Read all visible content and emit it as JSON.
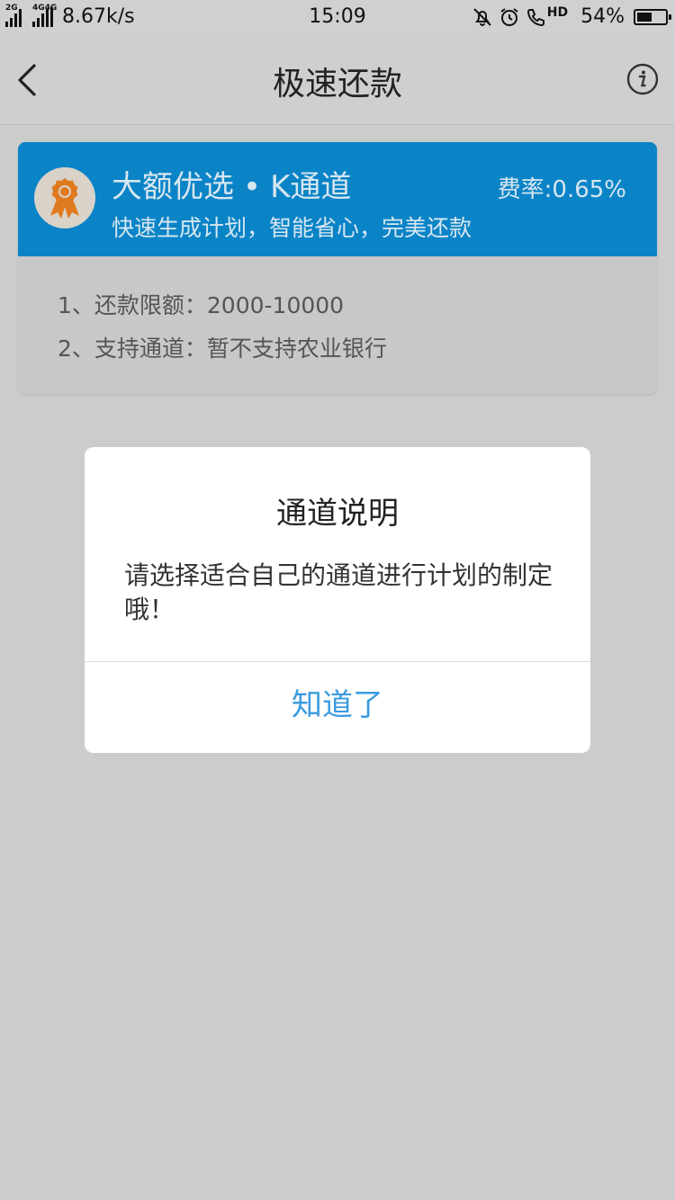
{
  "status_bar": {
    "net1": "2G",
    "net2": "4G4G",
    "speed": "8.67k/s",
    "time": "15:09",
    "hd": "HD",
    "battery": "54%",
    "battery_level": 0.54
  },
  "header": {
    "title": "极速还款"
  },
  "card": {
    "title_main": "大额优选",
    "title_dot": "•",
    "title_channel": "K通道",
    "rate": "费率:0.65%",
    "subtitle": "快速生成计划，智能省心，完美还款",
    "items": [
      "1、还款限额：2000-10000",
      "2、支持通道：暂不支持农业银行"
    ],
    "colors": {
      "header_bg": "#0a84c7",
      "badge": "#e07a1f"
    }
  },
  "dialog": {
    "title": "通道说明",
    "message": "请选择适合自己的通道进行计划的制定哦！",
    "confirm": "知道了",
    "accent": "#3a9be0"
  }
}
